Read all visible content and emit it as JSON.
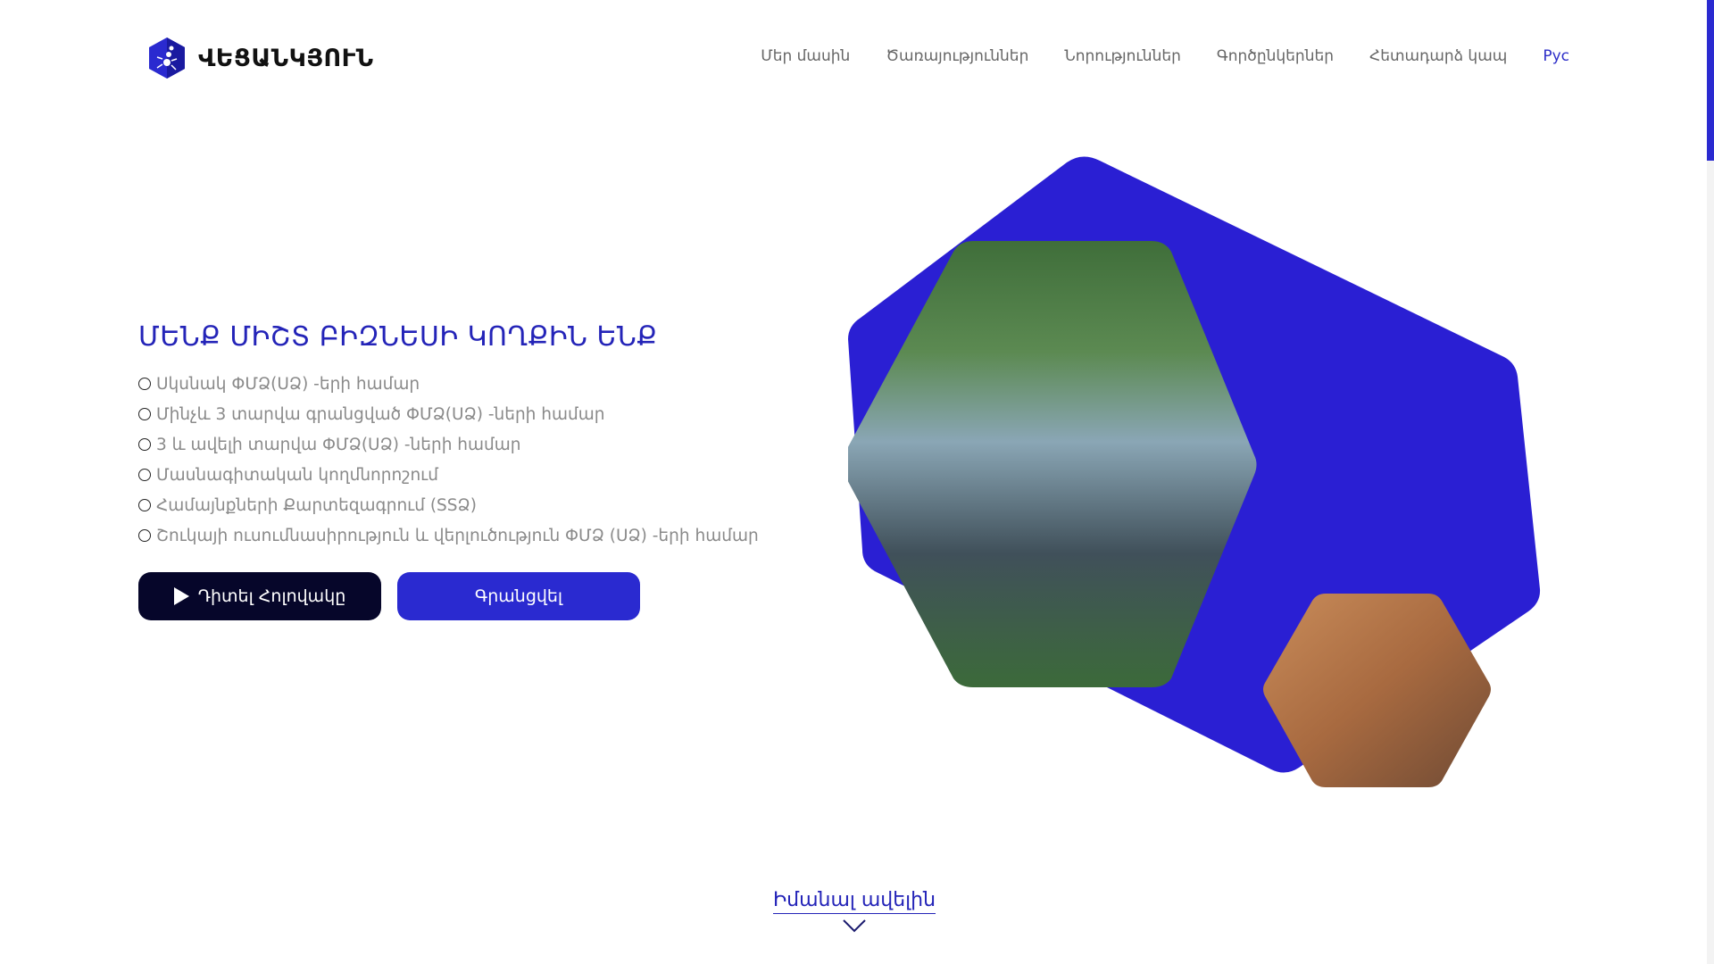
{
  "brand": {
    "name": "ՎԵՑԱՆԿՅՈՒՆ",
    "logo_icon": "ant-hexagon-logo",
    "accent": "#2a2ad0"
  },
  "nav": {
    "items": [
      "Մեր մասին",
      "Ծառայություններ",
      "Նորություններ",
      "Գործընկերներ",
      "Հետադարձ կապ"
    ],
    "lang": "Рус"
  },
  "hero": {
    "title": "ՄԵՆՔ ՄԻՇՏ ԲԻԶՆԵՍԻ ԿՈՂՔԻՆ ԵՆՔ",
    "list": [
      "Սկսնակ ՓՄՁ(ՍՁ) -երի համար",
      "Մինչև 3 տարվա գրանցված ՓՄՁ(ՍՁ) -ների համար",
      "3 և ավելի տարվա ՓՄՁ(ՍՁ) -ների համար",
      "Մասնագիտական կողմնորոշում",
      "Համայնքների Քարտեզագրում (SSՁ)",
      "Շուկայի ուսումնասիրություն և վերլուծություն ՓՄՁ (ՍՁ) -երի համար"
    ],
    "btn_video": "Դիտել Հոլովակը",
    "btn_register": "Գրանցվել"
  },
  "learn_more": "Իմանալ ավելին"
}
